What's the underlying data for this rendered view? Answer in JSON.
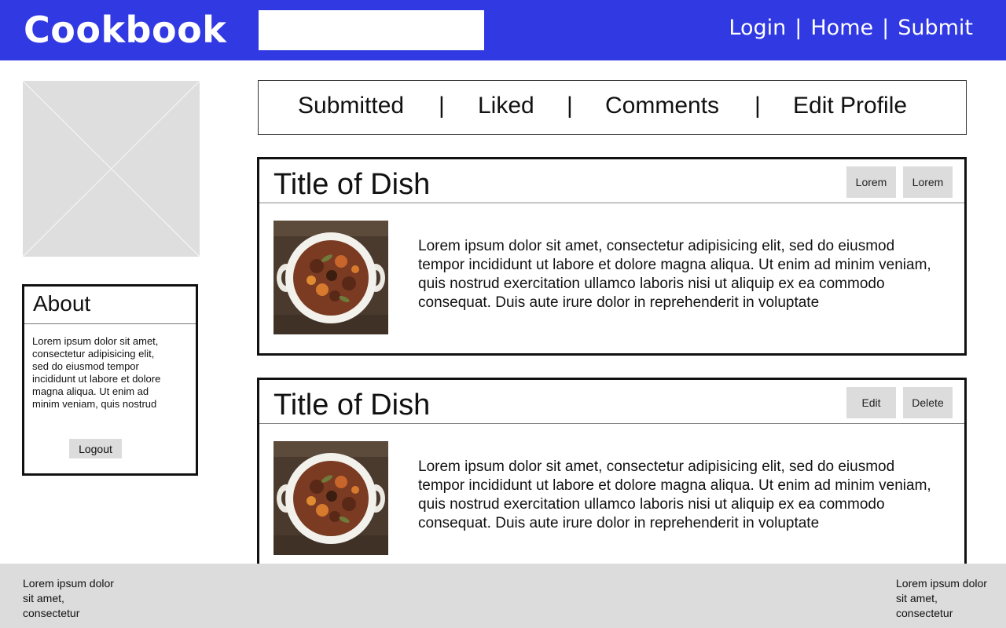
{
  "header": {
    "logo": "Cookbook",
    "search": {
      "placeholder": "",
      "value": ""
    },
    "nav": [
      {
        "label": "Login"
      },
      {
        "label": "Home"
      },
      {
        "label": "Submit"
      }
    ],
    "nav_separator": "|",
    "background_color": "#3139e3"
  },
  "sidebar": {
    "profile_image": {
      "icon": "image-placeholder-icon"
    },
    "about": {
      "title": "About",
      "text": "Lorem ipsum dolor sit amet, consectetur adipisicing elit, sed do eiusmod tempor incididunt ut labore et dolore magna aliqua. Ut enim ad minim veniam, quis nostrud",
      "logout_label": "Logout"
    }
  },
  "tabs": {
    "items": [
      {
        "label": "Submitted"
      },
      {
        "label": "Liked"
      },
      {
        "label": "Comments"
      },
      {
        "label": "Edit Profile"
      }
    ],
    "separator": "|"
  },
  "dishes": [
    {
      "title": "Title of Dish",
      "actions": [
        {
          "label": "Lorem"
        },
        {
          "label": "Lorem"
        }
      ],
      "image": {
        "icon": "beef-stew-photo"
      },
      "description": "Lorem ipsum dolor sit amet, consectetur adipisicing elit, sed do eiusmod tempor incididunt ut labore et dolore magna aliqua. Ut enim ad minim veniam, quis nostrud exercitation ullamco laboris nisi ut aliquip ex ea commodo consequat. Duis aute irure dolor in reprehenderit in voluptate"
    },
    {
      "title": "Title of Dish",
      "actions": [
        {
          "label": "Edit"
        },
        {
          "label": "Delete"
        }
      ],
      "image": {
        "icon": "beef-stew-photo"
      },
      "description": "Lorem ipsum dolor sit amet, consectetur adipisicing elit, sed do eiusmod tempor incididunt ut labore et dolore magna aliqua. Ut enim ad minim veniam, quis nostrud exercitation ullamco laboris nisi ut aliquip ex ea commodo consequat. Duis aute irure dolor in reprehenderit in voluptate"
    }
  ],
  "footer": {
    "left_text": "Lorem ipsum dolor sit amet, consectetur",
    "right_text": "Lorem ipsum dolor sit amet, consectetur",
    "background_color": "#dcdcdc"
  }
}
